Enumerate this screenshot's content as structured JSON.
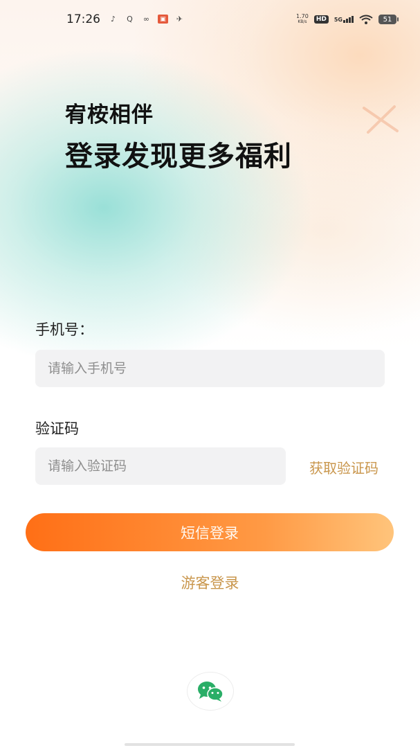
{
  "status_bar": {
    "time": "17:26",
    "net_speed_value": "1.70",
    "net_speed_unit": "KB/s",
    "hd_label": "HD",
    "network_label": "5G",
    "battery_level": "51"
  },
  "header": {
    "subtitle": "宥桉相伴",
    "title": "登录发现更多福利"
  },
  "form": {
    "phone_label": "手机号：",
    "phone_placeholder": "请输入手机号",
    "code_label": "验证码",
    "code_placeholder": "请输入验证码",
    "get_code_label": "获取验证码"
  },
  "actions": {
    "sms_login_label": "短信登录",
    "guest_login_label": "游客登录"
  },
  "colors": {
    "accent_orange": "#ff7a22",
    "link_gold": "#c9964c",
    "wechat_green": "#2aae67"
  }
}
